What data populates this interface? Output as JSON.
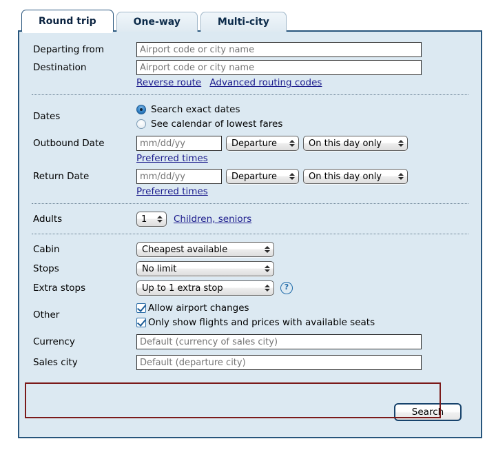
{
  "tabs": [
    {
      "label": "Round trip",
      "active": true
    },
    {
      "label": "One-way",
      "active": false
    },
    {
      "label": "Multi-city",
      "active": false
    }
  ],
  "form": {
    "departing_from": {
      "label": "Departing from",
      "placeholder": "Airport code or city name",
      "value": ""
    },
    "destination": {
      "label": "Destination",
      "placeholder": "Airport code or city name",
      "value": ""
    },
    "route_links": {
      "reverse_route": "Reverse route",
      "advanced_routing_codes": "Advanced routing codes"
    },
    "dates": {
      "label": "Dates",
      "options": [
        {
          "label": "Search exact dates",
          "selected": true
        },
        {
          "label": "See calendar of lowest fares",
          "selected": false
        }
      ]
    },
    "outbound": {
      "label": "Outbound Date",
      "date_placeholder": "mm/dd/yy",
      "date_value": "",
      "time_type": "Departure",
      "day_range": "On this day only",
      "preferred_times_link": "Preferred times"
    },
    "return": {
      "label": "Return Date",
      "date_placeholder": "mm/dd/yy",
      "date_value": "",
      "time_type": "Departure",
      "day_range": "On this day only",
      "preferred_times_link": "Preferred times"
    },
    "adults": {
      "label": "Adults",
      "count": "1",
      "children_seniors_link": "Children, seniors"
    },
    "cabin": {
      "label": "Cabin",
      "value": "Cheapest available"
    },
    "stops": {
      "label": "Stops",
      "value": "No limit"
    },
    "extra_stops": {
      "label": "Extra stops",
      "value": "Up to 1 extra stop",
      "help_icon": "question-mark-circle-icon",
      "help_glyph": "?"
    },
    "other": {
      "label": "Other",
      "checkboxes": [
        {
          "label": "Allow airport changes",
          "checked": true
        },
        {
          "label": "Only show flights and prices with available seats",
          "checked": true
        }
      ]
    },
    "currency": {
      "label": "Currency",
      "placeholder": "Default (currency of sales city)",
      "value": ""
    },
    "sales_city": {
      "label": "Sales city",
      "placeholder": "Default (departure city)",
      "value": ""
    },
    "search_button": "Search"
  },
  "colors": {
    "panel_background": "#dce9f2",
    "panel_border": "#27557c",
    "link": "#1a1a8c",
    "annotation": "#7b1a1a",
    "accent_blue": "#1f6aa8"
  }
}
